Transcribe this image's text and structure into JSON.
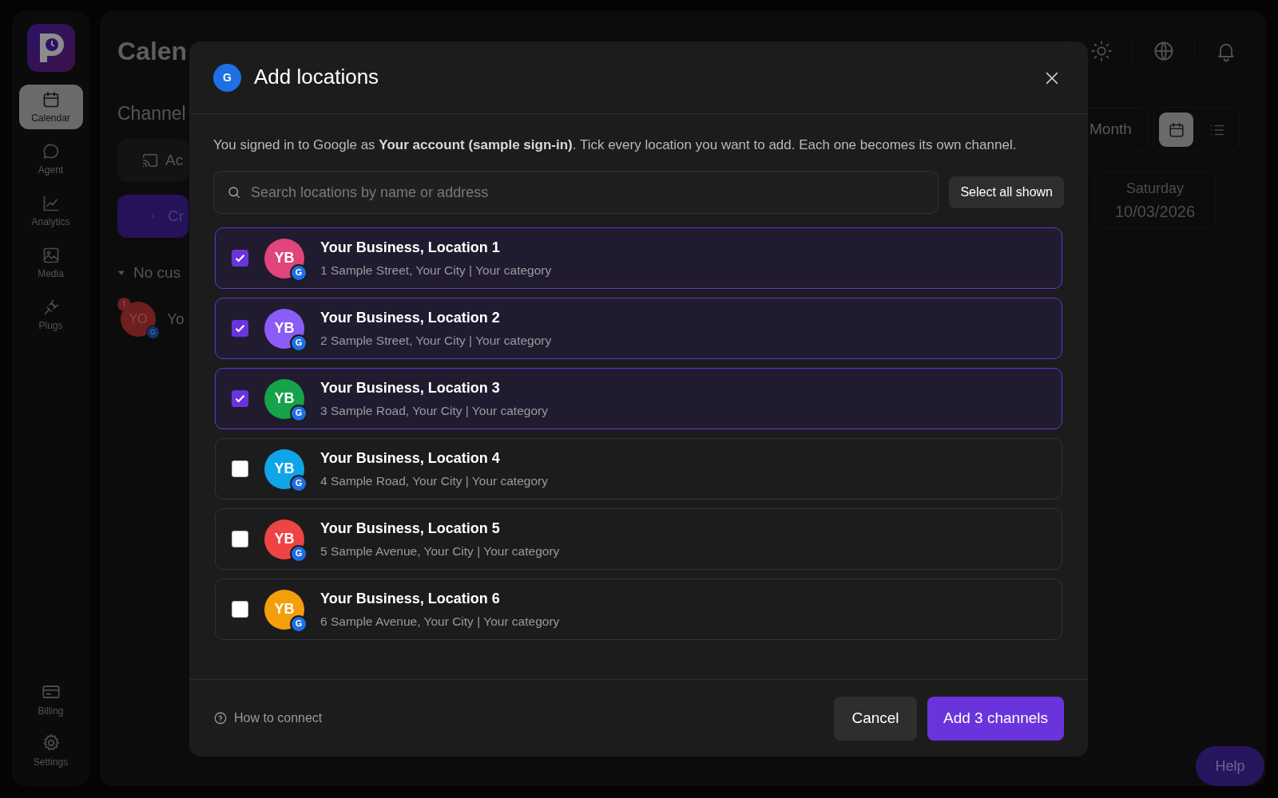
{
  "sidebar": {
    "items": [
      {
        "label": "Calendar",
        "selected": true
      },
      {
        "label": "Agent",
        "selected": false
      },
      {
        "label": "Analytics",
        "selected": false
      },
      {
        "label": "Media",
        "selected": false
      },
      {
        "label": "Plugs",
        "selected": false
      }
    ],
    "bottom_items": [
      {
        "label": "Billing"
      },
      {
        "label": "Settings"
      }
    ]
  },
  "header": {
    "title": "Calen"
  },
  "channels_panel": {
    "heading": "Channel",
    "add_button": "Ac",
    "create_button": "Cr",
    "group": {
      "label": "No cus",
      "expanded": true
    },
    "channel": {
      "initials": "YO",
      "name": "Yo",
      "alert": "!",
      "badge": "G"
    }
  },
  "view_switch": {
    "period": "Month",
    "modes": [
      {
        "selected": true
      },
      {
        "selected": false
      }
    ]
  },
  "day": {
    "weekday": "Saturday",
    "date": "10/03/2026"
  },
  "help_button": "Help",
  "dialog": {
    "badge": "G",
    "title": "Add locations",
    "intro": "You signed in to Google as **Your account (sample sign-in)**. Tick every location you want to add. Each one becomes its own channel.",
    "search": {
      "placeholder": "Search locations by name or address"
    },
    "select_all": "Select all shown",
    "locations": [
      {
        "name": "Your Business, Location 1",
        "address": "1 Sample Street, Your City | Your category",
        "initials": "YB",
        "badge": "G",
        "color": "#e0457b",
        "checked": true
      },
      {
        "name": "Your Business, Location 2",
        "address": "2 Sample Street, Your City | Your category",
        "initials": "YB",
        "badge": "G",
        "color": "#8b5cf6",
        "checked": true
      },
      {
        "name": "Your Business, Location 3",
        "address": "3 Sample Road, Your City | Your category",
        "initials": "YB",
        "badge": "G",
        "color": "#16a34a",
        "checked": true
      },
      {
        "name": "Your Business, Location 4",
        "address": "4 Sample Road, Your City | Your category",
        "initials": "YB",
        "badge": "G",
        "color": "#0ea5e9",
        "checked": false
      },
      {
        "name": "Your Business, Location 5",
        "address": "5 Sample Avenue, Your City | Your category",
        "initials": "YB",
        "badge": "G",
        "color": "#ef4444",
        "checked": false
      },
      {
        "name": "Your Business, Location 6",
        "address": "6 Sample Avenue, Your City | Your category",
        "initials": "YB",
        "badge": "G",
        "color": "#f59e0b",
        "checked": false
      }
    ],
    "footer": {
      "help_link": "How to connect",
      "cancel": "Cancel",
      "submit": "Add 3 channels"
    }
  }
}
